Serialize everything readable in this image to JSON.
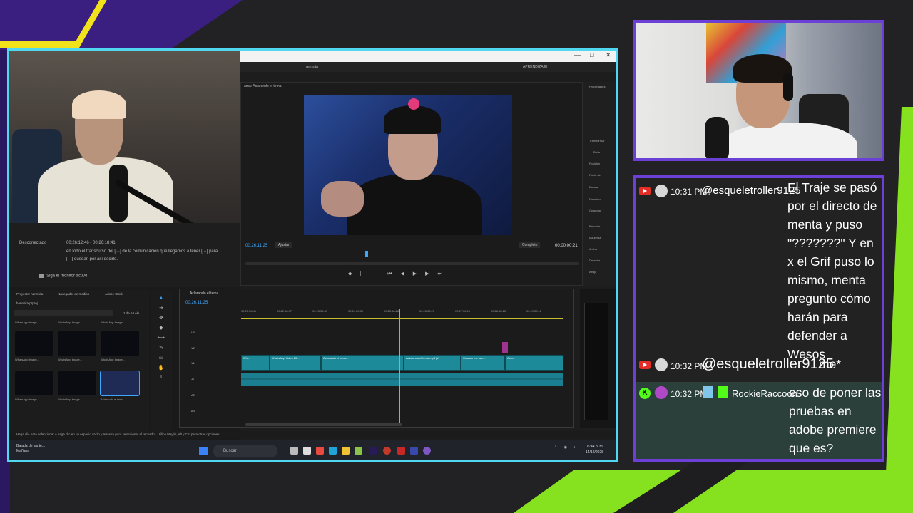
{
  "stream_title": "hannsita",
  "transcript": {
    "status": "Desconectado",
    "time_range": "00:26:12:46 - 00:26:18:41",
    "text": "en todo el transcurso del [···] de la comunicación que llegamos a tener [···] para [···] quedar, por así decirlo.",
    "checkbox_label": "Siga el monitor activo"
  },
  "premiere": {
    "window_controls": [
      "—",
      "□",
      "✕"
    ],
    "user": "hannsita",
    "learn_label": "APRENDIZAJE",
    "monitor_tab": "ama: Aclarando el tema",
    "program_time": "00:26:11:25",
    "fit_label": "Ajustar",
    "quality_label": "Completo",
    "duration": "00:00:00:21",
    "properties": {
      "tab": "Propiedades",
      "items": [
        "Transformar",
        "Bolla",
        "Posición",
        "Punto de",
        "Escala",
        "Rotación",
        "Opacidad",
        "Recortar",
        "Izquierda",
        "Arriba",
        "Derecha",
        "Abajo",
        "Ajustar ve"
      ]
    },
    "project": {
      "tabs": [
        "Proyecto: hannsita",
        "Navegador de medios",
        "Adobe Stock"
      ],
      "file": "hannsita.prproj",
      "count": "1 de 54 ele...",
      "thumbnails": [
        {
          "label": "WhatsApp Image...",
          "dur": "4;59"
        },
        {
          "label": "WhatsApp Image...",
          "dur": "4;59"
        },
        {
          "label": "WhatsApp Image...",
          "dur": "4;59"
        },
        {
          "label": "WhatsApp Image...",
          "dur": "4;59"
        },
        {
          "label": "WhatsApp Image...",
          "dur": "4;59"
        },
        {
          "label": "WhatsApp Image...",
          "dur": "4;59"
        },
        {
          "label": "WhatsApp Image...",
          "dur": "4;59"
        },
        {
          "label": "WhatsApp Image...",
          "dur": "4;59"
        },
        {
          "label": "Aclarando el tema...",
          "dur": "6"
        }
      ]
    },
    "timeline": {
      "tab": "Aclarando el tema",
      "timecode": "00:26:11:25",
      "ruler": [
        "00:21:58:41",
        "00:22:58:37",
        "00:23:58:33",
        "00:24:58:30",
        "00:25:58:26",
        "00:26:58:23",
        "00:27:58:19",
        "00:28:58:15",
        "00:29:58:12"
      ],
      "tracks": [
        "V3",
        "V2",
        "V1",
        "A1",
        "A2",
        "A3"
      ],
      "clips": [
        "Wh...",
        "WhatsApp Video 20...",
        "Aclarando el tema...",
        "Aclarando el tema.mp4 [V]",
        "Cuando me la e...",
        "Acla..."
      ]
    },
    "status_hint": "Haga clic para seleccionar o haga clic en un espacio vacío y arrastre para seleccionar el recuadro. Utilice Mayús, Alt y Ctrl para otras opciones."
  },
  "taskbar": {
    "weather_title": "Bajada de las te...",
    "weather_sub": "Mañana",
    "search_placeholder": "Buscar",
    "time": "06:44 p. m.",
    "date": "14/12/2025"
  },
  "chat": {
    "messages": [
      {
        "platform": "youtube",
        "time": "10:31 PM",
        "user": "@esqueletroller9125",
        "text": "El Traje se pasó por el directo de menta y puso \"???????\" Y en x el Grif puso lo mismo, menta pregunto cómo harán para defender a Wesos"
      },
      {
        "platform": "youtube",
        "time": "10:32 PM",
        "user": "@esqueletroller9125",
        "text": "me*"
      },
      {
        "platform": "kick",
        "time": "10:32 PM",
        "user": "RookieRaccoon",
        "text": "eso de poner las pruebas en adobe premiere que es? XDDDDD"
      }
    ]
  },
  "colors": {
    "frame_cyan": "#4fd8ef",
    "frame_purple": "#6c3fd6",
    "accent_green": "#86e21f",
    "youtube_red": "#e52d27",
    "kick_green": "#53fc18",
    "premiere_blue": "#3fa6ff"
  }
}
